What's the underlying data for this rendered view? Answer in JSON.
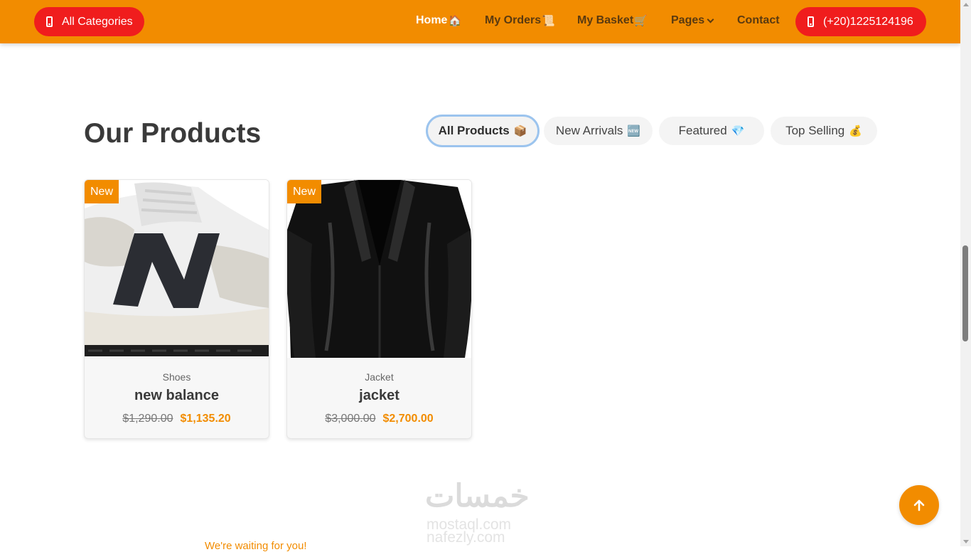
{
  "navbar": {
    "categories_label": "All Categories",
    "phone_label": "(+20)1225124196",
    "links": [
      {
        "label": "Home",
        "emoji": "🏠"
      },
      {
        "label": "My Orders",
        "emoji": "📜"
      },
      {
        "label": "My Basket",
        "emoji": "🛒"
      },
      {
        "label": "Pages",
        "emoji": ""
      },
      {
        "label": "Contact",
        "emoji": ""
      }
    ]
  },
  "products_section": {
    "title": "Our Products",
    "tabs": [
      {
        "label": "All Products",
        "emoji": "📦",
        "active": true
      },
      {
        "label": "New Arrivals",
        "emoji": "🆕",
        "active": false
      },
      {
        "label": "Featured",
        "emoji": "💎",
        "active": false
      },
      {
        "label": "Top Selling",
        "emoji": "💰",
        "active": false
      }
    ],
    "products": [
      {
        "badge": "New",
        "category": "Shoes",
        "name": "new balance",
        "old_price": "$1,290.00",
        "price": "$1,135.20",
        "image": "sneaker"
      },
      {
        "badge": "New",
        "category": "Jacket",
        "name": "jacket",
        "old_price": "$3,000.00",
        "price": "$2,700.00",
        "image": "leather-jacket"
      }
    ]
  },
  "footer_peek": "We're waiting for you!",
  "watermark": {
    "logo": "خمسات",
    "url1": "mostaql.com",
    "url2": "nafezly.com"
  },
  "colors": {
    "primary": "#f28c00",
    "accent_red": "#f01d1d",
    "active_tab_border": "#9cc4ee"
  }
}
